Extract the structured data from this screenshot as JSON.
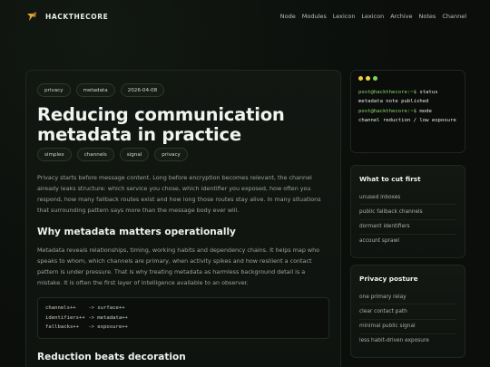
{
  "brand": {
    "name": "HACKTHECORE",
    "logo": "hackthecore-logo",
    "accent": "#e0a43a"
  },
  "nav": [
    "Node",
    "Modules",
    "Lexicon",
    "Lexicon",
    "Archive",
    "Notes",
    "Channel"
  ],
  "article": {
    "tags": [
      "privacy",
      "metadata",
      "2026-04-08"
    ],
    "title": "Reducing communication metadata in practice",
    "subtags": [
      "simplex",
      "channels",
      "signal",
      "privacy"
    ],
    "intro": "Privacy starts before message content. Long before encryption becomes relevant, the channel already leaks structure: which service you chose, which identifier you exposed, how often you respond, how many fallback routes exist and how long those routes stay alive. In many situations that surrounding pattern says more than the message body ever will.",
    "section1": {
      "heading": "Why metadata matters operationally",
      "body": "Metadata reveals relationships, timing, working habits and dependency chains. It helps map who speaks to whom, which channels are primary, when activity spikes and how resilient a contact pattern is under pressure. That is why treating metadata as harmless background detail is a mistake. It is often the first layer of intelligence available to an observer."
    },
    "code": [
      "channels++    -> surface++",
      "identifiers++ -> metadata++",
      "fallbacks++   -> exposure++"
    ],
    "section2": {
      "heading": "Reduction beats decoration"
    }
  },
  "terminal": {
    "dot_colors": [
      "#f3c64a",
      "#e9d84a",
      "#7fd45a"
    ],
    "lines": [
      {
        "prompt": "post@hackthecore:~$",
        "cmd": "status"
      },
      {
        "prompt": "",
        "cmd": "metadata note published"
      },
      {
        "prompt": "post@hackthecore:~$",
        "cmd": "mode"
      },
      {
        "prompt": "",
        "cmd": "channel reduction / low exposure"
      }
    ]
  },
  "panels": [
    {
      "title": "What to cut first",
      "items": [
        "unused inboxes",
        "public fallback channels",
        "dormant identifiers",
        "account sprawl"
      ]
    },
    {
      "title": "Privacy posture",
      "items": [
        "one primary relay",
        "clear contact path",
        "minimal public signal",
        "less habit-driven exposure"
      ]
    }
  ]
}
